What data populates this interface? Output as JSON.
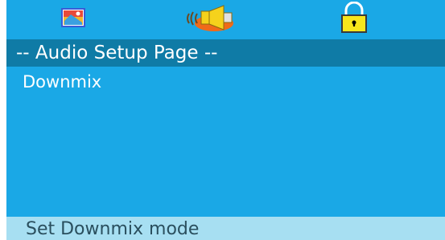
{
  "tabs": [
    {
      "icon": "general-setup-icon",
      "active": false
    },
    {
      "icon": "speaker-icon",
      "active": true
    },
    {
      "icon": "lock-icon",
      "active": false
    }
  ],
  "page": {
    "title": "-- Audio Setup Page --"
  },
  "menu": {
    "items": [
      {
        "label": "Downmix"
      }
    ]
  },
  "status": {
    "text": "Set Downmix mode"
  },
  "colors": {
    "background": "#1aa8e6",
    "title_bar": "#0f7ba6",
    "status_bar": "#a7dff2",
    "status_text": "#2a4f5e",
    "text": "#ffffff"
  }
}
